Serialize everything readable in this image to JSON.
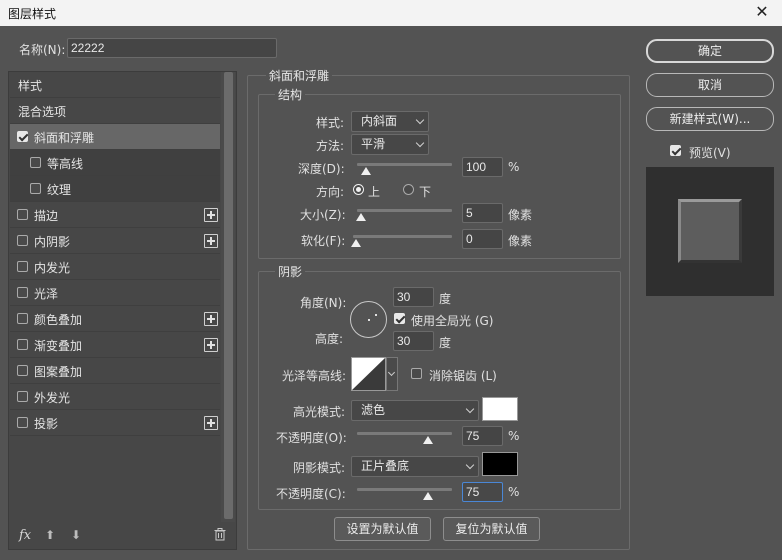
{
  "window": {
    "title": "图层样式",
    "close": "✕"
  },
  "name_field": {
    "label": "名称(N):",
    "value": "22222"
  },
  "styles_list": {
    "header": "样式",
    "blend": "混合选项",
    "items": [
      {
        "label": "斜面和浮雕",
        "checked": true,
        "selected": true,
        "plus": false
      },
      {
        "label": "等高线",
        "checked": false,
        "sub": true,
        "plus": false
      },
      {
        "label": "纹理",
        "checked": false,
        "sub": true,
        "plus": false
      },
      {
        "label": "描边",
        "checked": false,
        "plus": true
      },
      {
        "label": "内阴影",
        "checked": false,
        "plus": true
      },
      {
        "label": "内发光",
        "checked": false,
        "plus": false
      },
      {
        "label": "光泽",
        "checked": false,
        "plus": false
      },
      {
        "label": "颜色叠加",
        "checked": false,
        "plus": true
      },
      {
        "label": "渐变叠加",
        "checked": false,
        "plus": true
      },
      {
        "label": "图案叠加",
        "checked": false,
        "plus": false
      },
      {
        "label": "外发光",
        "checked": false,
        "plus": false
      },
      {
        "label": "投影",
        "checked": false,
        "plus": true
      }
    ],
    "bottom_icons": [
      "fx-icon",
      "move-up-icon",
      "move-down-icon",
      "trash-icon"
    ],
    "fx_label": "fx"
  },
  "bevel": {
    "title": "斜面和浮雕",
    "structure_title": "结构",
    "style_label": "样式:",
    "style_value": "内斜面",
    "method_label": "方法:",
    "method_value": "平滑",
    "depth_label": "深度(D):",
    "depth_value": "100",
    "depth_unit": "%",
    "depth_level": 0.01,
    "direction_label": "方向:",
    "direction_up": "上",
    "direction_down": "下",
    "size_label": "大小(Z):",
    "size_value": "5",
    "size_unit": "像素",
    "soften_label": "软化(F):",
    "soften_value": "0",
    "soften_unit": "像素"
  },
  "shading": {
    "title": "阴影",
    "angle_label": "角度(N):",
    "angle_value": "30",
    "angle_unit": "度",
    "global_light_label": "使用全局光 (G)",
    "global_light_checked": true,
    "altitude_label": "高度:",
    "altitude_value": "30",
    "altitude_unit": "度",
    "gloss_contour_label": "光泽等高线:",
    "antialias_label": "消除锯齿 (L)",
    "highlight_mode_label": "高光模式:",
    "highlight_mode_value": "滤色",
    "highlight_color": "#ffffff",
    "highlight_opacity_label": "不透明度(O):",
    "highlight_opacity_value": "75",
    "highlight_opacity_unit": "%",
    "shadow_mode_label": "阴影模式:",
    "shadow_mode_value": "正片叠底",
    "shadow_color": "#000000",
    "shadow_opacity_label": "不透明度(C):",
    "shadow_opacity_value": "75",
    "shadow_opacity_unit": "%"
  },
  "footer_buttons": {
    "set_default": "设置为默认值",
    "reset_default": "复位为默认值"
  },
  "right_buttons": {
    "ok": "确定",
    "cancel": "取消",
    "new_style": "新建样式(W)...",
    "preview_label": "预览(V)",
    "preview_checked": true
  }
}
